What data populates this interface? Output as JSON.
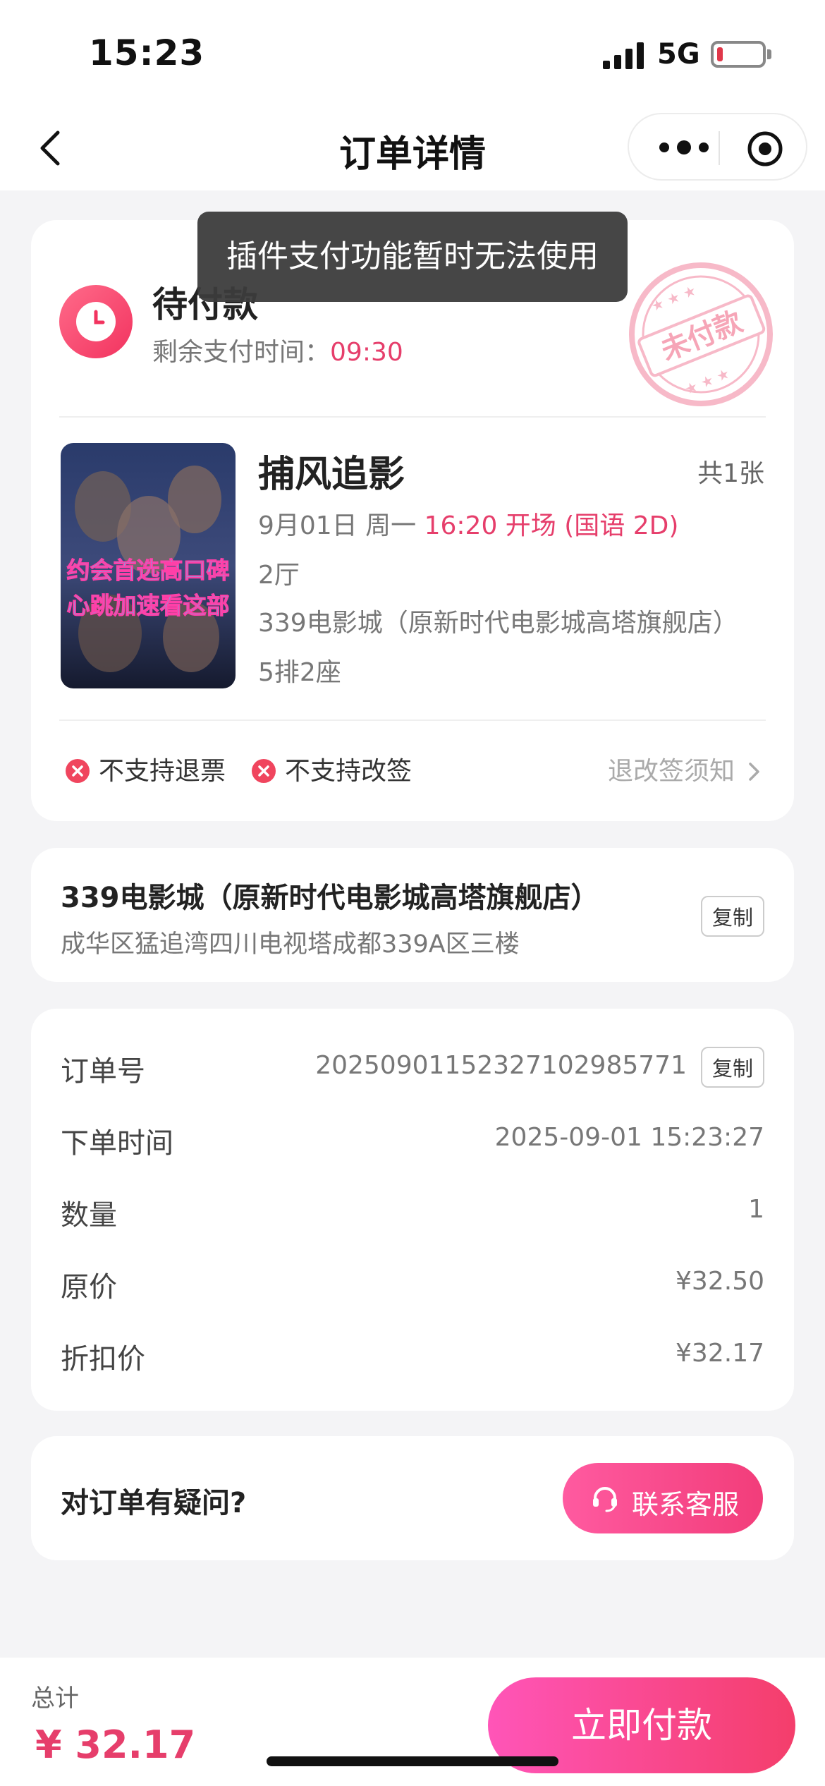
{
  "status_bar": {
    "time": "15:23",
    "network": "5G"
  },
  "nav": {
    "title": "订单详情"
  },
  "toast": {
    "text": "插件支付功能暂时无法使用"
  },
  "order_status": {
    "title": "待付款",
    "remain_label": "剩余支付时间：",
    "countdown": "09:30",
    "stamp_text": "未付款"
  },
  "movie": {
    "title": "捕风追影",
    "quantity": "共1张",
    "date": "9月01日 周一 ",
    "showtime": "16:20 开场 (国语 2D)",
    "hall": "2厅",
    "cinema": "339电影城（原新时代电影城高塔旗舰店）",
    "seat": "5排2座",
    "poster_lines": [
      "约会首选高口碑",
      "心跳加速看这部"
    ]
  },
  "policies": {
    "no_refund": "不支持退票",
    "no_change": "不支持改签",
    "link": "退改签须知"
  },
  "cinema_card": {
    "name": "339电影城（原新时代电影城高塔旗舰店）",
    "address": "成华区猛追湾四川电视塔成都339A区三楼",
    "copy": "复制"
  },
  "order_info": {
    "rows": [
      {
        "label": "订单号",
        "value": "20250901152327102985771"
      },
      {
        "label": "下单时间",
        "value": "2025-09-01 15:23:27"
      },
      {
        "label": "数量",
        "value": "1"
      },
      {
        "label": "原价",
        "value": "¥32.50"
      },
      {
        "label": "折扣价",
        "value": "¥32.17"
      }
    ],
    "copy": "复制"
  },
  "help": {
    "question": "对订单有疑问?",
    "service": "联系客服"
  },
  "bottom": {
    "total_label": "总计",
    "total": "¥ 32.17",
    "pay": "立即付款"
  },
  "colors": {
    "accent": "#e63e6b",
    "pink_gradient_start": "#ff55b8"
  }
}
